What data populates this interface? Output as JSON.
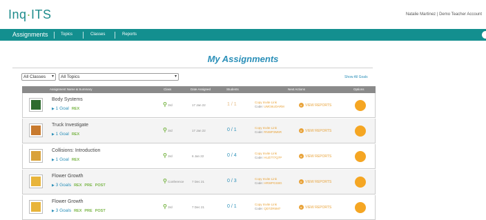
{
  "app": {
    "logo_prefix": "Inq",
    "logo_q": "·",
    "logo_suffix": "ITS",
    "user": "Natalie Martinez | Demo Teacher Account"
  },
  "nav": {
    "items": [
      "Assignments",
      "Topics",
      "Classes",
      "Reports"
    ]
  },
  "page_title": "My Assignments",
  "filters": {
    "class": "All Classes",
    "topic": "All Topics",
    "show_all": "Show All Goals"
  },
  "table": {
    "headers": [
      "Assignment Name & Summary",
      "Class",
      "Date Assigned",
      "Students",
      "Next Actions",
      "Options"
    ],
    "rows": [
      {
        "title": "Body Systems",
        "goals": "1 Goal",
        "tags": [
          "REX"
        ],
        "class": "3rd",
        "date": "17 Jan 22",
        "students": "1 / 1",
        "invite": "Copy Invite Link",
        "code_label": "Code:",
        "code": "UMG6UDARM",
        "report": "VIEW REPORTS",
        "thumb_color": "#2e6b2e"
      },
      {
        "title": "Truck Investigate",
        "goals": "1 Goal",
        "tags": [
          "REX"
        ],
        "class": "3rd",
        "date": "17 Jan 22",
        "students": "0 / 1",
        "invite": "Copy Invite Link",
        "code_label": "Code:",
        "code": "RNWP3M6R",
        "report": "VIEW REPORTS",
        "thumb_color": "#c87a2e"
      },
      {
        "title": "Collisions: Introduction",
        "goals": "1 Goal",
        "tags": [
          "REX"
        ],
        "class": "3rd",
        "date": "6 Jan 22",
        "students": "0 / 4",
        "invite": "Copy Invite Link",
        "code_label": "Code:",
        "code": "HUZ7T7Q7P",
        "report": "VIEW REPORTS",
        "thumb_color": "#d9a23a"
      },
      {
        "title": "Flower Growth",
        "goals": "3 Goals",
        "tags": [
          "REX",
          "PRE",
          "POST"
        ],
        "class": "Conference",
        "date": "7 Dec 21",
        "students": "0 / 3",
        "invite": "Copy Invite Link",
        "code_label": "Code:",
        "code": "HRWPGS8G",
        "report": "VIEW REPORTS",
        "thumb_color": "#e8b43a"
      },
      {
        "title": "Flower Growth",
        "goals": "3 Goals",
        "tags": [
          "REX",
          "PRE",
          "POST"
        ],
        "class": "3rd",
        "date": "7 Dec 21",
        "students": "0 / 1",
        "invite": "Copy Invite Link",
        "code_label": "Code:",
        "code": "QD7ZR5M7",
        "report": "VIEW REPORTS",
        "thumb_color": "#e8b43a"
      }
    ]
  }
}
